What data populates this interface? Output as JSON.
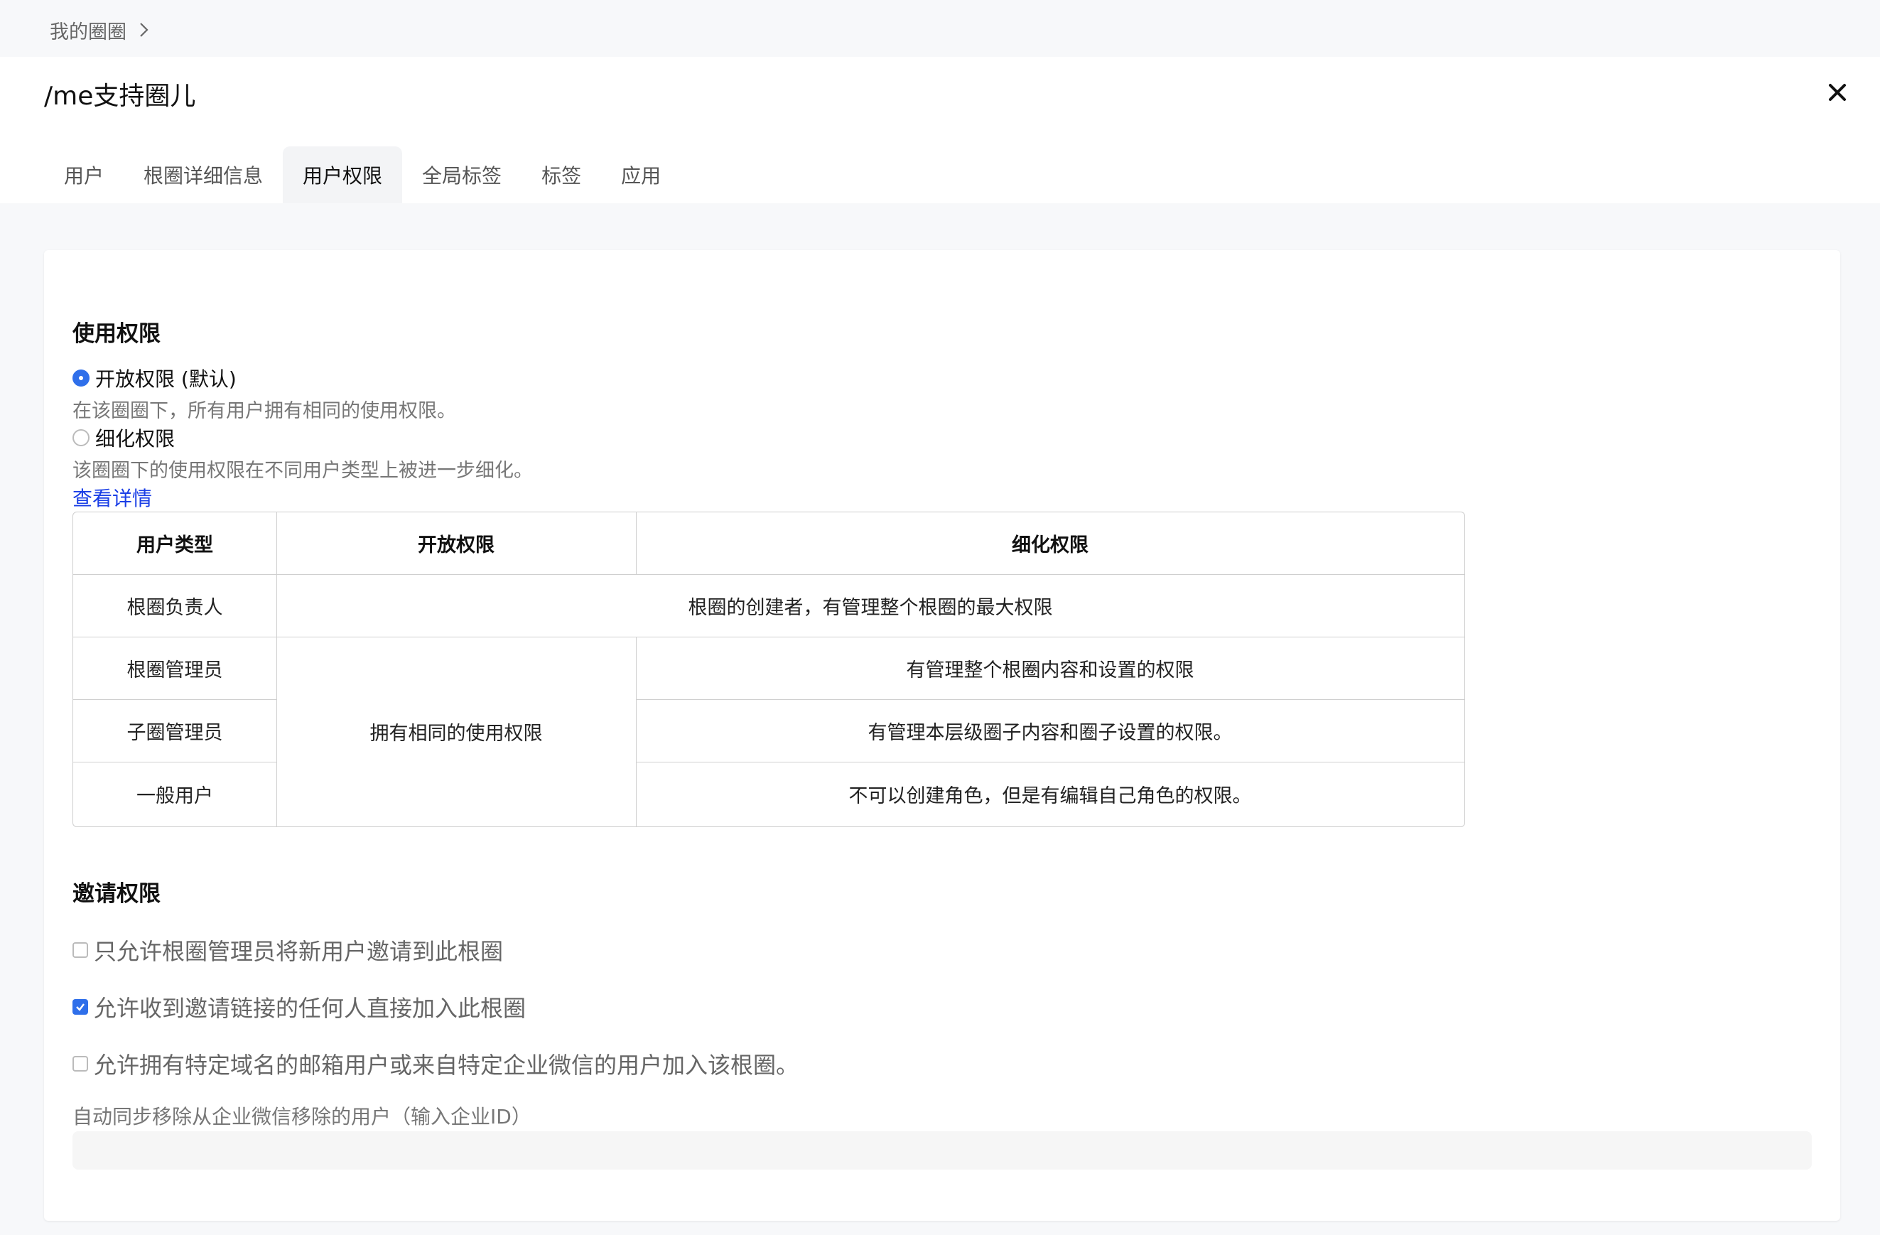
{
  "breadcrumb": {
    "label": "我的圈圈"
  },
  "header": {
    "title": "/me支持圈儿"
  },
  "tabs": [
    {
      "label": "用户"
    },
    {
      "label": "根圈详细信息"
    },
    {
      "label": "用户权限",
      "active": true
    },
    {
      "label": "全局标签"
    },
    {
      "label": "标签"
    },
    {
      "label": "应用"
    }
  ],
  "usage": {
    "title": "使用权限",
    "options": [
      {
        "label": "开放权限 (默认)",
        "desc": "在该圈圈下，所有用户拥有相同的使用权限。",
        "selected": true
      },
      {
        "label": "细化权限",
        "desc": "该圈圈下的使用权限在不同用户类型上被进一步细化。",
        "selected": false
      }
    ],
    "link": "查看详情"
  },
  "table": {
    "headers": [
      "用户类型",
      "开放权限",
      "细化权限"
    ],
    "rows": [
      {
        "type": "根圈负责人",
        "open": "",
        "fine": "根圈的创建者，有管理整个根圈的最大权限"
      },
      {
        "type": "根圈管理员",
        "open": "拥有相同的使用权限",
        "fine": "有管理整个根圈内容和设置的权限"
      },
      {
        "type": "子圈管理员",
        "open": "拥有相同的使用权限",
        "fine": "有管理本层级圈子内容和圈子设置的权限。"
      },
      {
        "type": "一般用户",
        "open": "拥有相同的使用权限",
        "fine": "不可以创建角色，但是有编辑自己角色的权限。"
      }
    ]
  },
  "invite": {
    "title": "邀请权限",
    "options": [
      {
        "label": "只允许根圈管理员将新用户邀请到此根圈",
        "checked": false
      },
      {
        "label": "允许收到邀请链接的任何人直接加入此根圈",
        "checked": true
      },
      {
        "label": "允许拥有特定域名的邮箱用户或来自特定企业微信的用户加入该根圈。",
        "checked": false
      }
    ],
    "field_label": "自动同步移除从企业微信移除的用户（输入企业ID）",
    "field_value": ""
  },
  "colors": {
    "accent": "#2f6fea",
    "link": "#1a3ee6",
    "background": "#f7f8fa"
  },
  "icons": {
    "breadcrumb": "chevron-right-icon",
    "close": "close-icon",
    "check": "check-icon"
  }
}
